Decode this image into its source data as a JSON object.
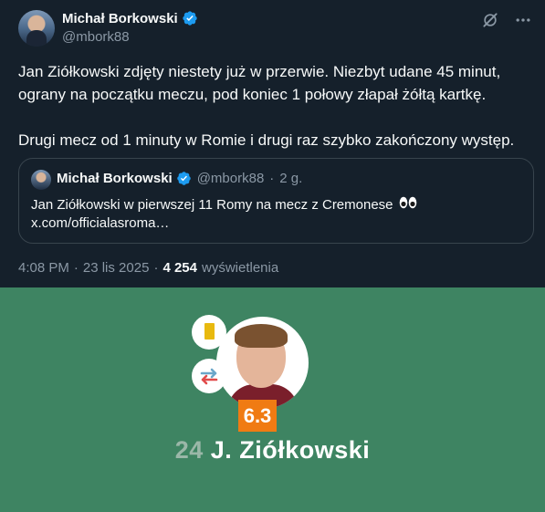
{
  "author": {
    "name": "Michał Borkowski",
    "handle": "@mbork88"
  },
  "tweet": {
    "line1": "Jan Ziółkowski zdjęty niestety już w przerwie. Niezbyt udane 45 minut,",
    "line2": "ograny na początku meczu, pod koniec 1 połowy złapał żółtą kartkę.",
    "line3": "Drugi mecz od 1 minuty w Romie i drugi raz szybko zakończony występ."
  },
  "quote": {
    "name": "Michał Borkowski",
    "handle": "@mbork88",
    "separator": "·",
    "age": "2 g.",
    "text": "Jan Ziółkowski w pierwszej 11 Romy na mecz z Cremonese",
    "link": "x.com/officialasroma…"
  },
  "meta": {
    "time": "4:08 PM",
    "sep1": "·",
    "date": "23 lis 2025",
    "sep2": "·",
    "views": "4 254",
    "views_label": "wyświetlenia"
  },
  "photo": {
    "rating": "6.3",
    "number": "24",
    "player_name": "J. Ziółkowski",
    "card_color": "#e8b90f",
    "pitch_color": "#3e8462",
    "rating_color": "#f07b13"
  },
  "icons": [
    "verified-badge-icon",
    "grok-icon",
    "more-icon",
    "eyes-emoji-icon",
    "yellow-card-icon",
    "substitution-icon"
  ]
}
